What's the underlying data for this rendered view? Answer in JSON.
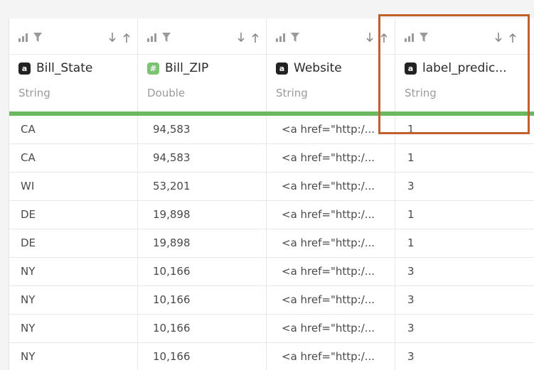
{
  "columns": [
    {
      "name": "Bill_State",
      "type": "String",
      "badge": "a",
      "badge_kind": "string"
    },
    {
      "name": "Bill_ZIP",
      "type": "Double",
      "badge": "#",
      "badge_kind": "number"
    },
    {
      "name": "Website",
      "type": "String",
      "badge": "a",
      "badge_kind": "string"
    },
    {
      "name": "label_predic...",
      "type": "String",
      "badge": "a",
      "badge_kind": "string"
    }
  ],
  "header_icons": [
    "bar-chart-icon",
    "filter-icon",
    "sort-descending-icon",
    "sort-ascending-icon"
  ],
  "rows": [
    [
      "CA",
      "94,583",
      "<a href=\"http:/...",
      "1"
    ],
    [
      "CA",
      "94,583",
      "<a href=\"http:/...",
      "1"
    ],
    [
      "WI",
      "53,201",
      "<a href=\"http:/...",
      "3"
    ],
    [
      "DE",
      "19,898",
      "<a href=\"http:/...",
      "1"
    ],
    [
      "DE",
      "19,898",
      "<a href=\"http:/...",
      "1"
    ],
    [
      "NY",
      "10,166",
      "<a href=\"http:/...",
      "3"
    ],
    [
      "NY",
      "10,166",
      "<a href=\"http:/...",
      "3"
    ],
    [
      "NY",
      "10,166",
      "<a href=\"http:/...",
      "3"
    ],
    [
      "NY",
      "10,166",
      "<a href=\"http:/...",
      "3"
    ]
  ],
  "colors": {
    "accent_bar": "#6bb85f",
    "highlight_border": "#c0612b",
    "string_badge": "#222222",
    "number_badge": "#7cc474"
  }
}
